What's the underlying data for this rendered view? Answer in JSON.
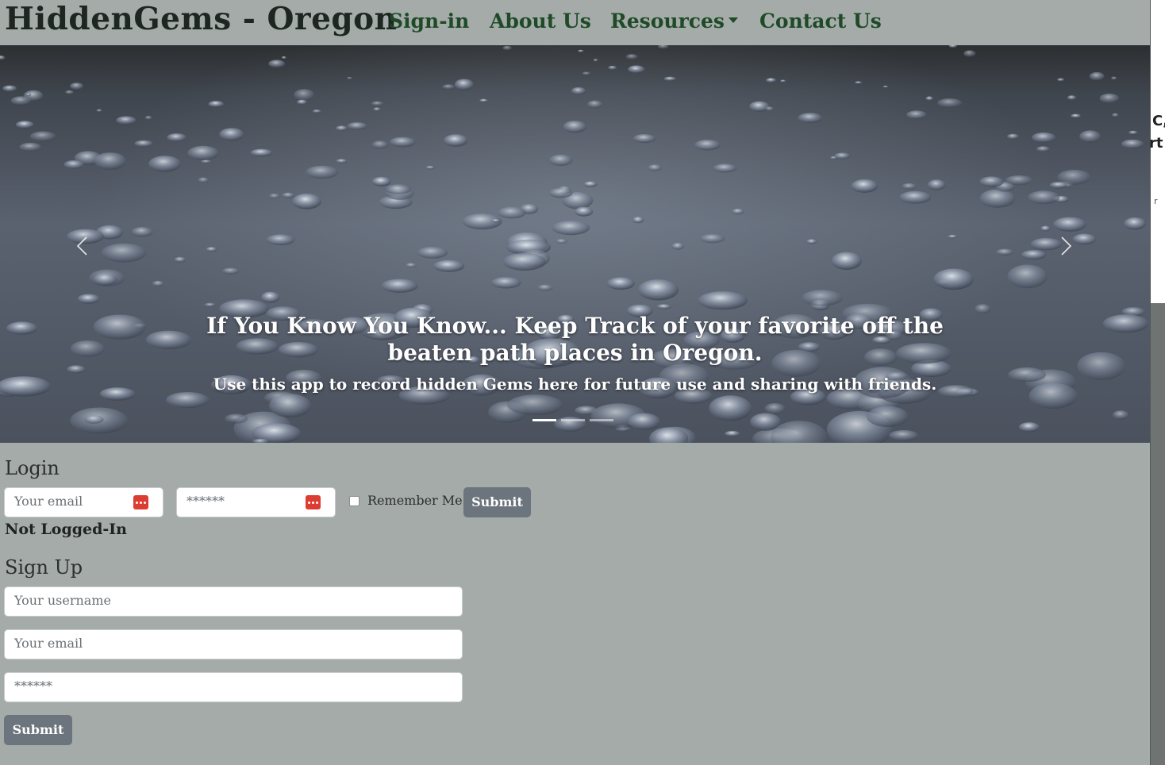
{
  "navbar": {
    "brand": "HiddenGems - Oregon",
    "links": {
      "signin": "Sign-in",
      "about": "About Us",
      "resources": "Resources",
      "contact": "Contact Us"
    }
  },
  "carousel": {
    "title": "If You Know You Know... Keep Track of your favorite off the beaten path places in Oregon.",
    "subtitle": "Use this app to record hidden Gems here for future use and sharing with friends.",
    "active_slide": 1,
    "slide_count": 3,
    "prev_icon": "chevron-left-icon",
    "next_icon": "chevron-right-icon"
  },
  "login": {
    "title": "Login",
    "email_placeholder": "Your email",
    "password_placeholder": "******",
    "remember_label": "Remember Me",
    "remember_checked": false,
    "submit_label": "Submit",
    "status": "Not Logged-In"
  },
  "signup": {
    "title": "Sign Up",
    "username_placeholder": "Your username",
    "email_placeholder": "Your email",
    "password_placeholder": "******",
    "submit_label": "Submit"
  },
  "side_panel": {
    "line1": "C,",
    "line2": "rt",
    "line3": "r"
  },
  "colors": {
    "background": "#a4aba8",
    "nav_link": "#1e4a27",
    "button": "#6c757d",
    "password_manager_icon": "#dc3c32"
  }
}
